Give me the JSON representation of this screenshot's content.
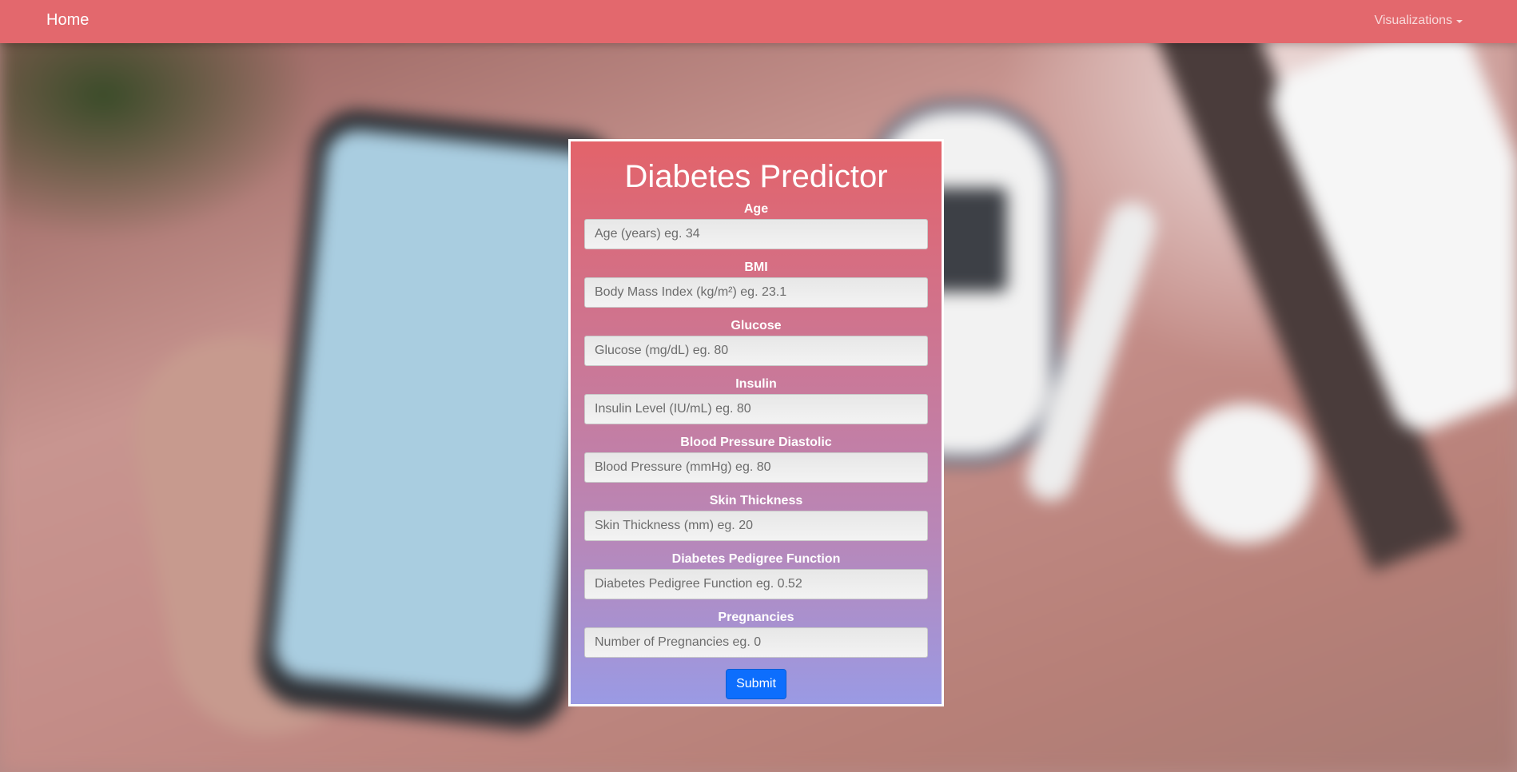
{
  "navbar": {
    "home_label": "Home",
    "visualizations_label": "Visualizations"
  },
  "form": {
    "title": "Diabetes Predictor",
    "fields": [
      {
        "label": "Age",
        "placeholder": "Age (years) eg. 34",
        "value": ""
      },
      {
        "label": "BMI",
        "placeholder": "Body Mass Index (kg/m²) eg. 23.1",
        "value": ""
      },
      {
        "label": "Glucose",
        "placeholder": "Glucose (mg/dL) eg. 80",
        "value": ""
      },
      {
        "label": "Insulin",
        "placeholder": "Insulin Level (IU/mL) eg. 80",
        "value": ""
      },
      {
        "label": "Blood Pressure Diastolic",
        "placeholder": "Blood Pressure (mmHg) eg. 80",
        "value": ""
      },
      {
        "label": "Skin Thickness",
        "placeholder": "Skin Thickness (mm) eg. 20",
        "value": ""
      },
      {
        "label": "Diabetes Pedigree Function",
        "placeholder": "Diabetes Pedigree Function eg. 0.52",
        "value": ""
      },
      {
        "label": "Pregnancies",
        "placeholder": "Number of Pregnancies eg. 0",
        "value": ""
      }
    ],
    "submit_label": "Submit"
  },
  "colors": {
    "navbar_bg": "#e3686d",
    "card_gradient_top": "#e3636a",
    "card_gradient_bottom": "#9a9ae4",
    "submit_bg": "#0d6efd"
  }
}
